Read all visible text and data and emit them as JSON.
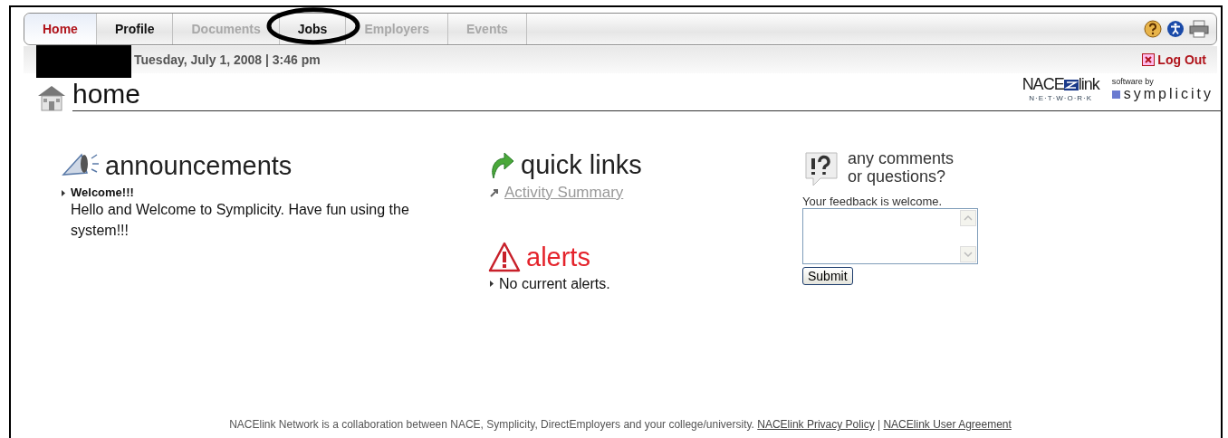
{
  "tabs": [
    {
      "label": "Home",
      "selected": true,
      "disabled": false
    },
    {
      "label": "Profile",
      "selected": false,
      "disabled": false
    },
    {
      "label": "Documents",
      "selected": false,
      "disabled": true
    },
    {
      "label": "Jobs",
      "selected": false,
      "disabled": false,
      "circled": true
    },
    {
      "label": "Employers",
      "selected": false,
      "disabled": true
    },
    {
      "label": "Events",
      "selected": false,
      "disabled": true
    }
  ],
  "date_bar": {
    "datetime": "Tuesday, July 1, 2008 | 3:46 pm",
    "logout": "Log Out"
  },
  "page_title": "home",
  "logos": {
    "nace_main": "NACE",
    "nace_link": "link",
    "nace_sub": "N·E·T·W·O·R·K",
    "software_by": "software by",
    "symplicity": "symplicity"
  },
  "announcements": {
    "title": "announcements",
    "items": [
      {
        "heading": "Welcome!!!",
        "body": "Hello and Welcome to Symplicity. Have fun using the system!!!"
      }
    ]
  },
  "quick_links": {
    "title": "quick links",
    "links": [
      "Activity Summary"
    ]
  },
  "alerts": {
    "title": "alerts",
    "items": [
      "No current alerts."
    ]
  },
  "comments": {
    "title_line1": "any comments",
    "title_line2": "or questions?",
    "prompt": "Your feedback is welcome.",
    "submit": "Submit"
  },
  "footer": {
    "text": "NACElink Network is a collaboration between NACE, Symplicity, DirectEmployers and your college/university.",
    "links": [
      "NACElink Privacy Policy",
      "NACElink User Agreement"
    ],
    "separator": "|"
  }
}
